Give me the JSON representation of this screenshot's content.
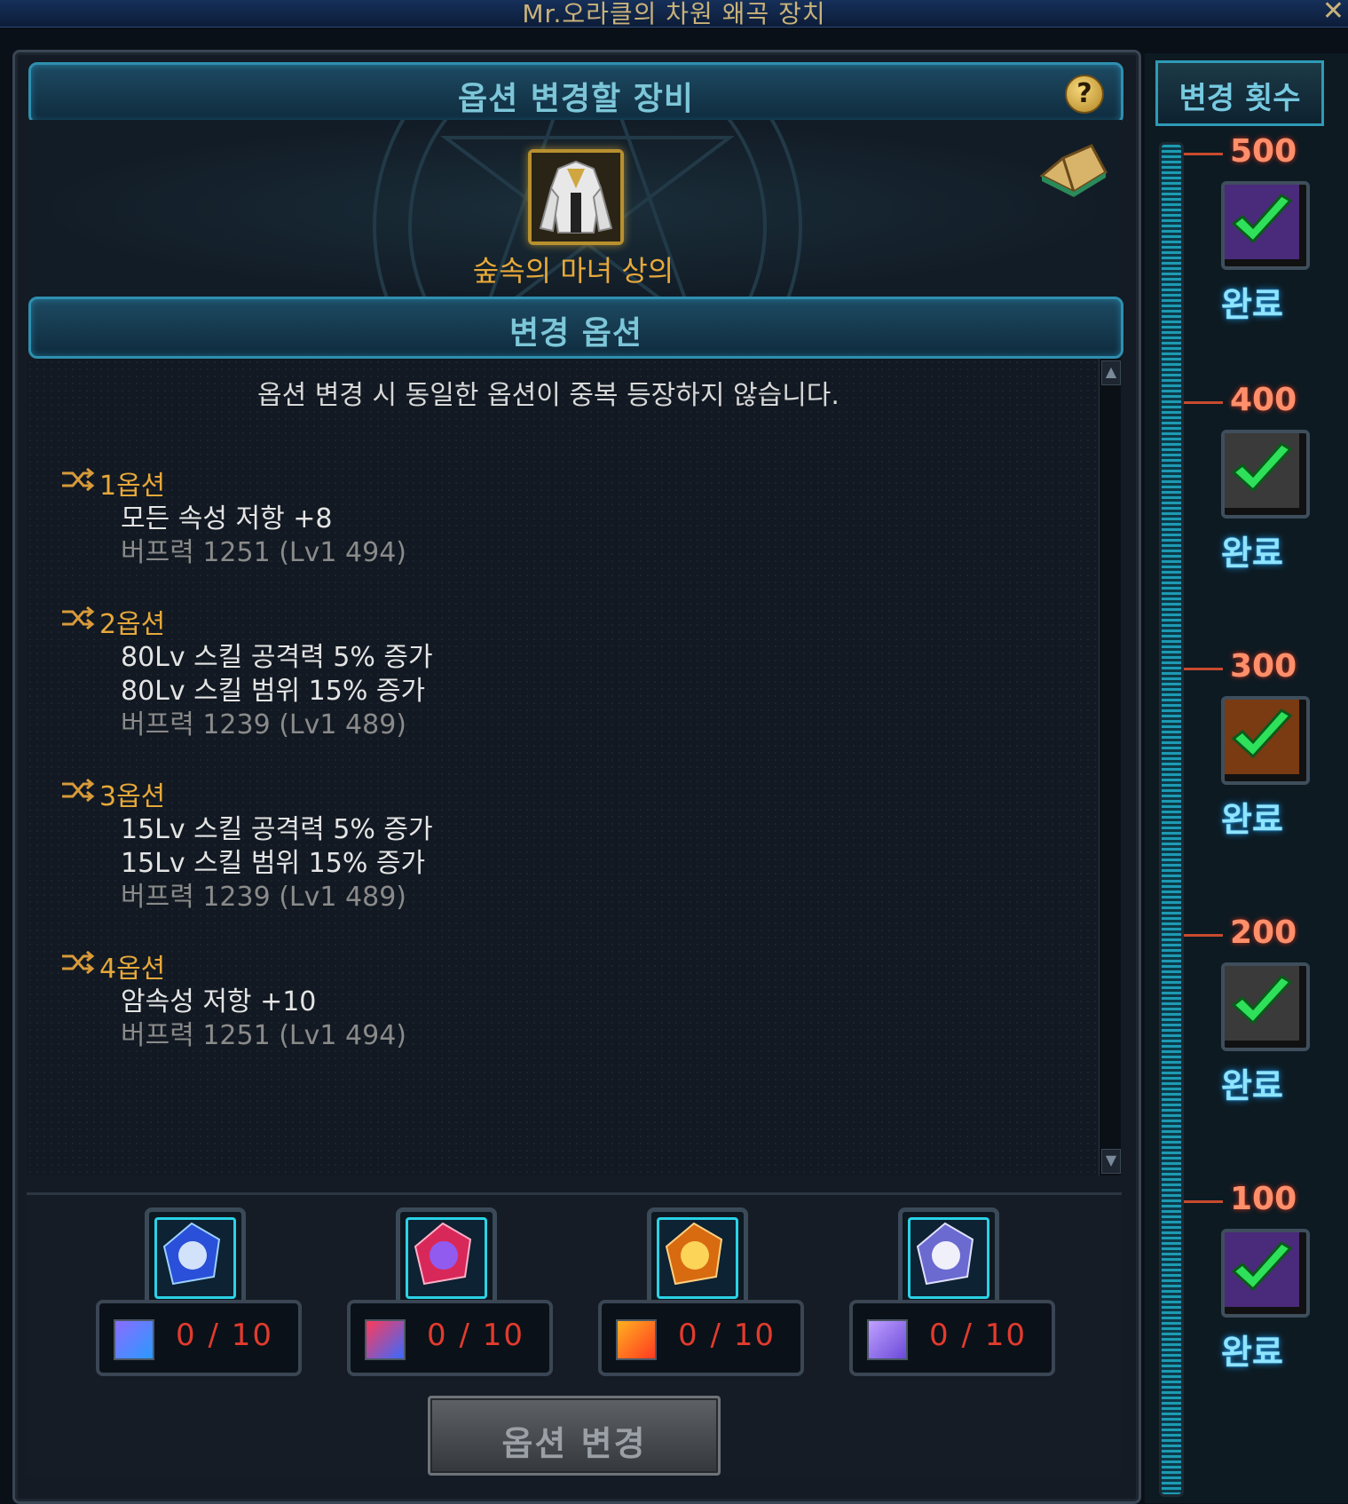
{
  "window": {
    "title": "Mr.오라클의 차원 왜곡 장치",
    "close_icon": "✕"
  },
  "equipment_section": {
    "header": "옵션 변경할 장비",
    "help_label": "?",
    "item_name": "숲속의 마녀 상의"
  },
  "options_section": {
    "header": "변경 옵션",
    "notice": "옵션 변경 시 동일한 옵션이 중복 등장하지 않습니다.",
    "options": [
      {
        "title": "1옵션",
        "lines": [
          "모든 속성 저항 +8"
        ],
        "buff": "버프력 1251 (Lv1 494)"
      },
      {
        "title": "2옵션",
        "lines": [
          "80Lv 스킬 공격력 5% 증가",
          "80Lv 스킬 범위 15% 증가"
        ],
        "buff": "버프력 1239 (Lv1 489)"
      },
      {
        "title": "3옵션",
        "lines": [
          "15Lv 스킬 공격력 5% 증가",
          "15Lv 스킬 범위 15% 증가"
        ],
        "buff": "버프력 1239 (Lv1 489)"
      },
      {
        "title": "4옵션",
        "lines": [
          "암속성 저항 +10"
        ],
        "buff": "버프력 1251 (Lv1 494)"
      }
    ]
  },
  "materials": [
    {
      "count": "0 / 10",
      "color": "#3d7bff"
    },
    {
      "count": "0 / 10",
      "color": "#ff4a6a"
    },
    {
      "count": "0 / 10",
      "color": "#ff9a1e"
    },
    {
      "count": "0 / 10",
      "color": "#b8b8ff"
    }
  ],
  "change_button": "옵션 변경",
  "side_panel": {
    "header": "변경 횟수",
    "milestones": [
      {
        "count": "500",
        "status": "완료"
      },
      {
        "count": "400",
        "status": "완료"
      },
      {
        "count": "300",
        "status": "완료"
      },
      {
        "count": "200",
        "status": "완료"
      },
      {
        "count": "100",
        "status": "완료"
      }
    ]
  }
}
